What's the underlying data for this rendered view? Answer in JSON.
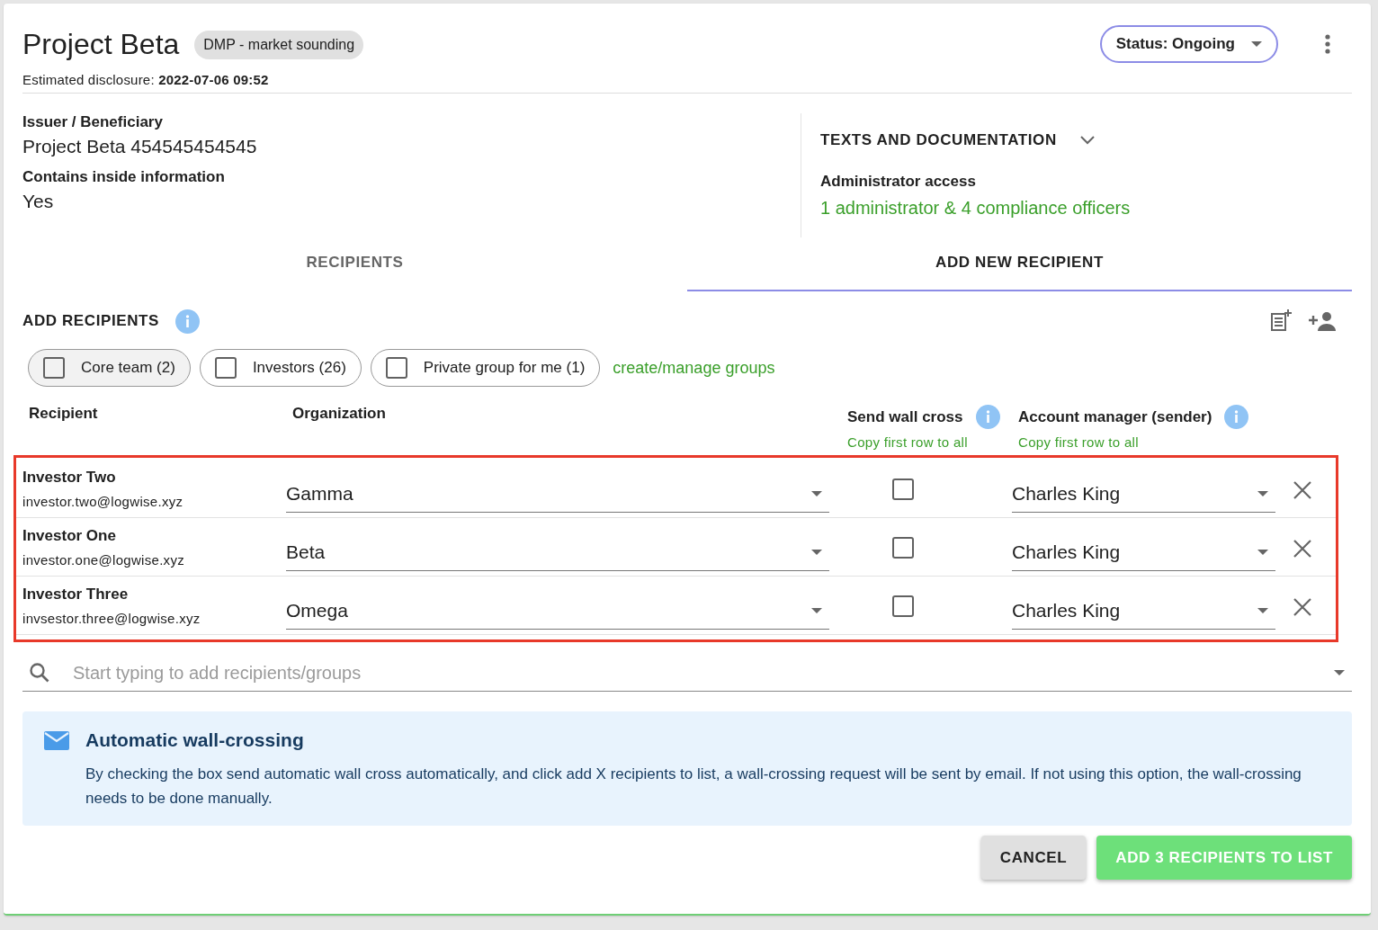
{
  "header": {
    "title": "Project Beta",
    "tag": "DMP - market sounding",
    "disclosure": "Estimated disclosure: **2022-07-06 09:52**",
    "status": "Status: Ongoing"
  },
  "details": [
    {
      "label": "Issuer / Beneficiary",
      "value": "Project Beta 454545454545"
    },
    {
      "label": "Contains inside information",
      "value": "Yes"
    }
  ],
  "documentation": {
    "title": "TEXTS AND DOCUMENTATION",
    "expanded": false,
    "access_label": "Administrator access",
    "access_link": "1 administrator & 4 compliance officers"
  },
  "tabs": [
    {
      "label": "RECIPIENTS",
      "selected": false
    },
    {
      "label": "ADD NEW RECIPIENT",
      "selected": true
    }
  ],
  "add_recipients": {
    "title": "ADD RECIPIENTS",
    "groups": [
      {
        "label": "Core team (2)",
        "checked": false,
        "highlighted": true
      },
      {
        "label": "Investors (26)",
        "checked": false,
        "highlighted": false
      },
      {
        "label": "Private group for me (1)",
        "checked": false,
        "highlighted": false
      }
    ],
    "manage_link": "create/manage groups"
  },
  "table": {
    "columns": [
      {
        "label": "Recipient"
      },
      {
        "label": "Organization"
      },
      {
        "label": "Send wall cross",
        "action": "Copy first row to all",
        "info": true
      },
      {
        "label": "Account manager (sender)",
        "action": "Copy first row to all",
        "info": true
      }
    ],
    "rows": [
      {
        "name": "Investor Two",
        "email": "investor.two@logwise.xyz",
        "organization": "Gamma",
        "send_wall_cross": false,
        "account_manager": "Charles King"
      },
      {
        "name": "Investor One",
        "email": "investor.one@logwise.xyz",
        "organization": "Beta",
        "send_wall_cross": false,
        "account_manager": "Charles King"
      },
      {
        "name": "Investor Three",
        "email": "invsestor.three@logwise.xyz",
        "organization": "Omega",
        "send_wall_cross": false,
        "account_manager": "Charles King"
      }
    ]
  },
  "search": {
    "placeholder": "Start typing to add recipients/groups"
  },
  "notice": {
    "title": "Automatic wall-crossing",
    "text": "By checking the box send automatic wall cross automatically, and click add X recipients to list, a wall-crossing request will be sent by email. If not using this option, the wall-crossing needs to be done manually."
  },
  "buttons": [
    {
      "label": "CANCEL",
      "kind": "secondary"
    },
    {
      "label": "ADD 3 RECIPIENTS TO LIST",
      "kind": "primary"
    }
  ]
}
